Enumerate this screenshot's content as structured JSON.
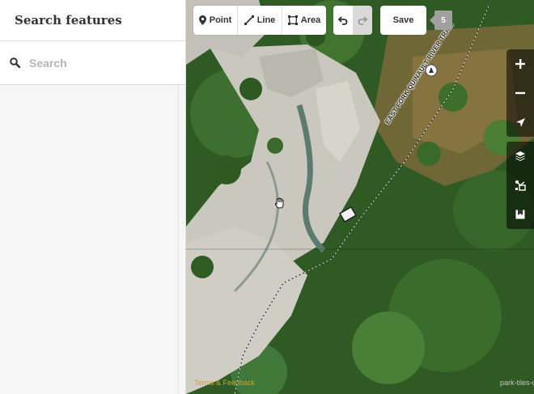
{
  "sidebar": {
    "title": "Search features",
    "search": {
      "value": "",
      "placeholder": "Search",
      "icon": "search-icon"
    }
  },
  "toolbar": {
    "modes": [
      {
        "label": "Point",
        "icon": "point-icon"
      },
      {
        "label": "Line",
        "icon": "line-icon"
      },
      {
        "label": "Area",
        "icon": "area-icon"
      }
    ],
    "undo_icon": "undo-icon",
    "redo_icon": "redo-icon",
    "save_label": "Save",
    "save_count": "5"
  },
  "map": {
    "trail_label": "EAST FORK QUINAULT RIVER TRAIL",
    "controls": [
      "zoom-in-icon",
      "zoom-out-icon",
      "geolocate-icon",
      "layers-icon",
      "map-data-icon",
      "issues-icon"
    ]
  },
  "footer": {
    "terms_link": "Terms & Feedback",
    "attribution": "park-tiles-o"
  },
  "colors": {
    "accent": "#c9a52e",
    "forest": "#2e5a22",
    "riverbed": "#c8c6bd",
    "meadow": "#8a7040"
  }
}
